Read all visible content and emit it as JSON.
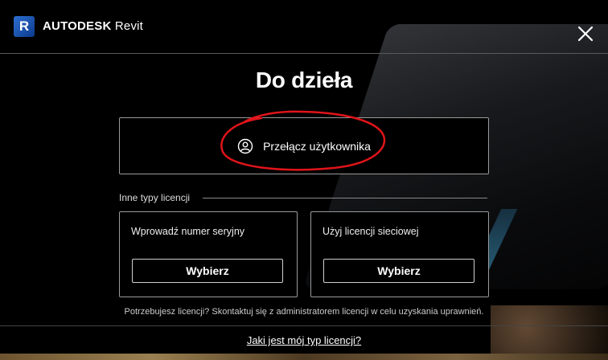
{
  "header": {
    "logo_letter": "R",
    "brand_bold": "AUTODESK",
    "brand_product": "Revit"
  },
  "main": {
    "title": "Do dzieła",
    "switch_user_label": "Przełącz użytkownika",
    "other_license_types_label": "Inne typy licencji",
    "cards": [
      {
        "title": "Wprowadź numer seryjny",
        "button_label": "Wybierz"
      },
      {
        "title": "Użyj licencji sieciowej",
        "button_label": "Wybierz"
      }
    ],
    "note": "Potrzebujesz licencji? Skontaktuj się z administratorem licencji w celu uzyskania uprawnień.",
    "license_type_link": "Jaki jest mój typ licencji?"
  },
  "colors": {
    "background": "#000000",
    "annotation_circle": "#e0141a",
    "logo_blue": "#2e6fd0"
  },
  "icons": [
    "close-icon",
    "user-circle-icon",
    "revit-logo-icon"
  ]
}
